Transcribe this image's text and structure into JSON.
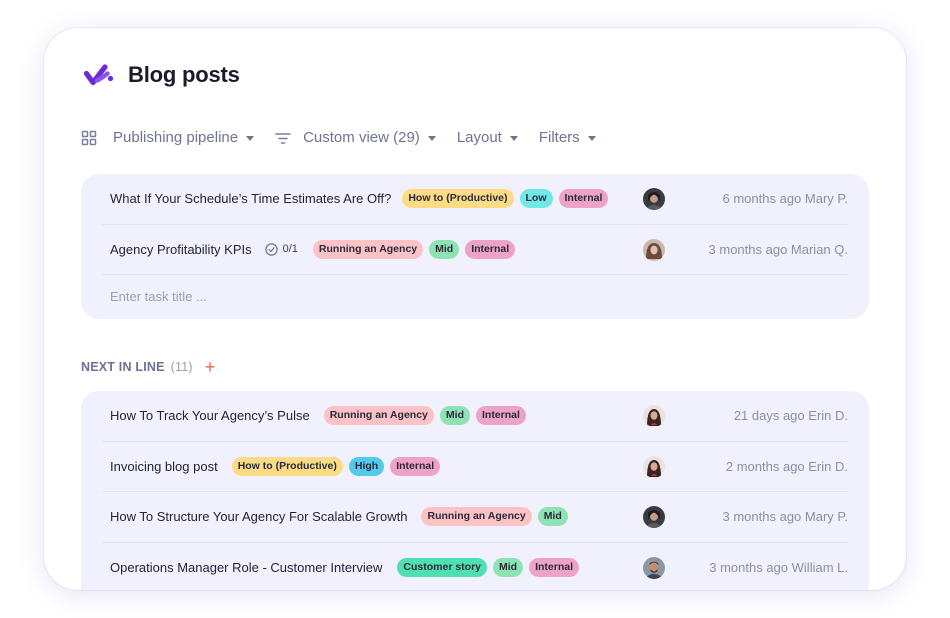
{
  "page": {
    "title": "Blog posts"
  },
  "toolbar": {
    "pipeline_label": "Publishing pipeline",
    "view_label": "Custom view (29)",
    "layout_label": "Layout",
    "filters_label": "Filters"
  },
  "colors": {
    "how_to": "#fbdb84",
    "agency": "#fcc3c7",
    "customer_story": "#4fe0b2",
    "low": "#6fe8e8",
    "mid": "#8de3b4",
    "high": "#53c9ec",
    "internal": "#eda3c7",
    "add": "#f0623e",
    "group_bg": "#f0f1fd"
  },
  "group1": {
    "rows": [
      {
        "title": "What If Your Schedule’s Time Estimates Are Off?",
        "tags": [
          "How to (Productive)",
          "Low",
          "Internal"
        ],
        "avatar": "avatar-mary",
        "meta": "6 months ago Mary P."
      },
      {
        "title": "Agency Profitability KPIs",
        "checklist": "0/1",
        "tags": [
          "Running an Agency",
          "Mid",
          "Internal"
        ],
        "avatar": "avatar-marian",
        "meta": "3 months ago Marian Q."
      }
    ],
    "input_placeholder": "Enter task title ..."
  },
  "section": {
    "name": "NEXT IN LINE",
    "count": "(11)",
    "add": "+"
  },
  "group2": {
    "rows": [
      {
        "title": "How To Track Your Agency’s Pulse",
        "tags": [
          "Running an Agency",
          "Mid",
          "Internal"
        ],
        "avatar": "avatar-erin",
        "meta": "21 days ago Erin D."
      },
      {
        "title": "Invoicing blog post",
        "tags": [
          "How to (Productive)",
          "High",
          "Internal"
        ],
        "avatar": "avatar-erin",
        "meta": "2 months ago Erin D."
      },
      {
        "title": "How To Structure Your Agency For Scalable Growth",
        "tags": [
          "Running an Agency",
          "Mid"
        ],
        "avatar": "avatar-mary",
        "meta": "3 months ago Mary P."
      },
      {
        "title": "Operations Manager Role - Customer Interview",
        "tags": [
          "Customer story",
          "Mid",
          "Internal"
        ],
        "avatar": "avatar-william",
        "meta": "3 months ago William L."
      }
    ]
  }
}
